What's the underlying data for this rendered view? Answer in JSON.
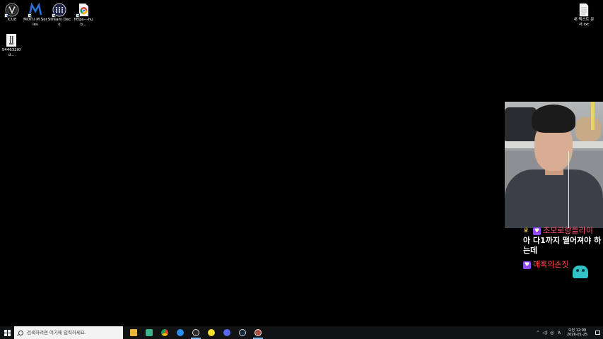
{
  "desktop": {
    "icons": [
      {
        "label": "iCUE"
      },
      {
        "label": "MOTU M Series"
      },
      {
        "label": "Stream Deck"
      },
      {
        "label": "https---hub..."
      },
      {
        "label": "544632f0d..."
      },
      {
        "label": "새 텍스트 문서.txt"
      }
    ]
  },
  "chat": {
    "messages": [
      {
        "user": "조모로랑들라이",
        "text": "아 다1까지 떨어져야 하는데"
      },
      {
        "user": "매혹의손짓",
        "text": ""
      }
    ]
  },
  "taskbar": {
    "search_placeholder": "검색하려면 여기에 입력하세요.",
    "pinned": [
      "file-explorer",
      "green-app",
      "chrome",
      "blue-app",
      "obs",
      "kakaotalk",
      "discord",
      "steam",
      "game-app"
    ],
    "tray": {
      "time": "오전 12:09",
      "date": "2026-01-25"
    }
  },
  "colors": {
    "taskbar_bg": "#111214",
    "chat_badge": "#9147ff",
    "chat_user_1": "#ff5b7a",
    "chat_user_2": "#ff4646"
  }
}
